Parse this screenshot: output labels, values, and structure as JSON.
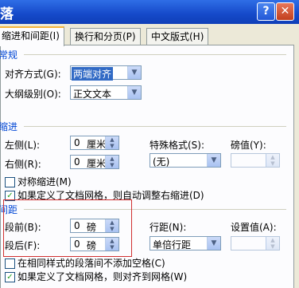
{
  "window": {
    "title": "落",
    "help_symbol": "?",
    "close_symbol": "✕"
  },
  "tabs": [
    {
      "label": "缩进和间距(I)"
    },
    {
      "label": "换行和分页(P)"
    },
    {
      "label": "中文版式(H)"
    }
  ],
  "general": {
    "title": "常规",
    "alignment": {
      "label": "对齐方式(G):",
      "value": "两端对齐"
    },
    "outline_level": {
      "label": "大纲级别(O):",
      "value": "正文文本"
    }
  },
  "indent": {
    "title": "缩进",
    "left": {
      "label": "左侧(L):",
      "value": "0",
      "unit": "厘米"
    },
    "right": {
      "label": "右侧(R):",
      "value": "0",
      "unit": "厘米"
    },
    "special": {
      "label": "特殊格式(S):",
      "value": "(无)"
    },
    "by": {
      "label": "磅值(Y):",
      "value": ""
    },
    "mirror": {
      "label": "对称缩进(M)",
      "checked": false
    },
    "auto_adjust": {
      "label": "如果定义了文档网格，则自动调整右缩进(D)",
      "checked": true
    }
  },
  "spacing": {
    "title": "间距",
    "before": {
      "label": "段前(B):",
      "value": "0",
      "unit": "磅"
    },
    "after": {
      "label": "段后(F):",
      "value": "0",
      "unit": "磅"
    },
    "line_spacing": {
      "label": "行距(N):",
      "value": "单倍行距"
    },
    "at": {
      "label": "设置值(A):",
      "value": ""
    },
    "no_space_same_style": {
      "label": "在相同样式的段落间不添加空格(C)",
      "checked": false
    },
    "snap_to_grid": {
      "label": "如果定义了文档网格，则对齐到网格(W)",
      "checked": true
    }
  },
  "icons": {
    "dropdown": "chevron-down-icon",
    "spinner": "spinner-arrows-icon",
    "check": "checkmark-icon"
  },
  "colors": {
    "titlebar": "#1549c9",
    "section_title": "#0046d5",
    "highlight": "#316ac5",
    "annotation_box": "#d03030"
  }
}
